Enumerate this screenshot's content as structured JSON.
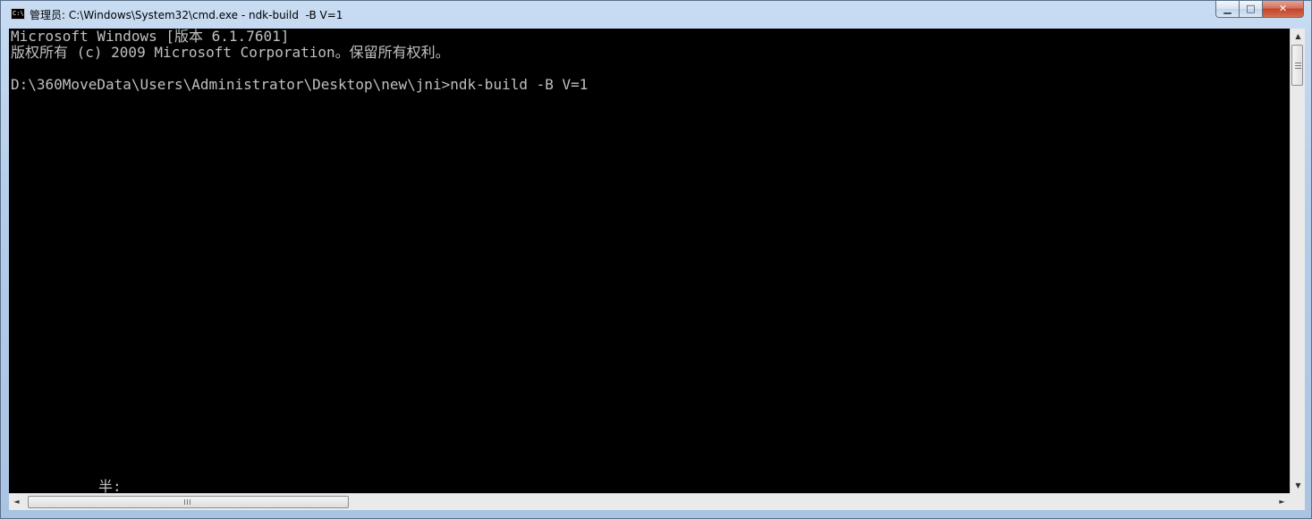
{
  "window": {
    "title": "管理员: C:\\Windows\\System32\\cmd.exe - ndk-build  -B V=1",
    "icon_name": "cmd-icon",
    "icon_text": "C:\\",
    "buttons": {
      "minimize_icon": "minimize-icon",
      "maximize_icon": "maximize-icon",
      "close_icon": "close-icon",
      "minimize_glyph": "▁",
      "maximize_glyph": "□",
      "close_glyph": "✕"
    }
  },
  "console": {
    "background": "#000000",
    "foreground": "#c0c0c0",
    "lines": [
      "Microsoft Windows [版本 6.1.7601]",
      "版权所有 (c) 2009 Microsoft Corporation。保留所有权利。",
      "",
      "D:\\360MoveData\\Users\\Administrator\\Desktop\\new\\jni>ndk-build -B V=1"
    ],
    "ime_status": "半:"
  },
  "scrollbars": {
    "up_arrow": "▲",
    "down_arrow": "▼",
    "left_arrow": "◄",
    "right_arrow": "►"
  }
}
